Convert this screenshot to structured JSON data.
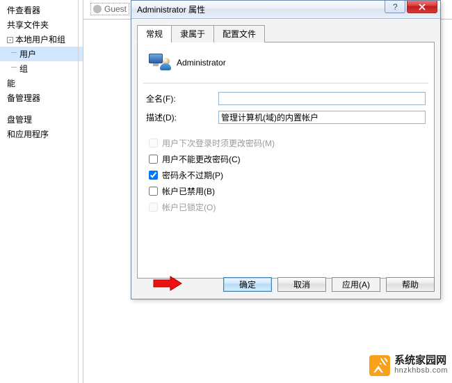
{
  "tree": {
    "items": [
      "件查看器",
      "共享文件夹",
      "本地用户和组",
      "能",
      "备管理器",
      "盘管理",
      "和应用程序"
    ],
    "children": [
      "用户",
      "组"
    ]
  },
  "rightHeader": {
    "item": "Guest"
  },
  "dialog": {
    "title": "Administrator 属性",
    "tabs": [
      "常规",
      "隶属于",
      "配置文件"
    ],
    "userName": "Administrator",
    "labels": {
      "fullName": "全名(F):",
      "description": "描述(D):"
    },
    "fields": {
      "fullName": "",
      "description": "管理计算机(域)的内置帐户"
    },
    "checks": [
      {
        "label": "用户下次登录时须更改密码(M)",
        "checked": false,
        "disabled": true
      },
      {
        "label": "用户不能更改密码(C)",
        "checked": false,
        "disabled": false
      },
      {
        "label": "密码永不过期(P)",
        "checked": true,
        "disabled": false
      },
      {
        "label": "帐户已禁用(B)",
        "checked": false,
        "disabled": false
      },
      {
        "label": "帐户已锁定(O)",
        "checked": false,
        "disabled": true
      }
    ],
    "buttons": {
      "ok": "确定",
      "cancel": "取消",
      "apply": "应用(A)",
      "help": "帮助"
    }
  },
  "watermark": {
    "name": "系统家园网",
    "url": "hnzkhbsb.com"
  }
}
